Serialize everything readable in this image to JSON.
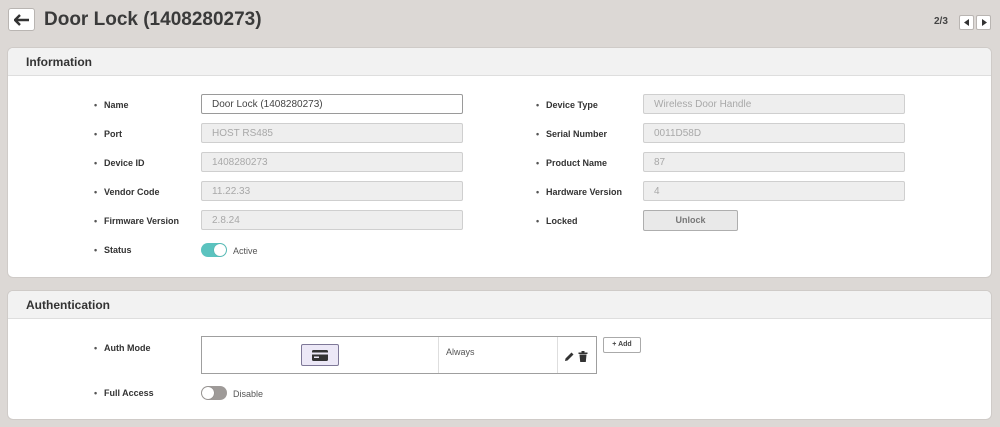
{
  "header": {
    "title": "Door Lock (1408280273)",
    "pager": "2/3"
  },
  "information": {
    "section_title": "Information",
    "left_fields": [
      {
        "label": "Name",
        "value": "Door Lock (1408280273)"
      },
      {
        "label": "Port",
        "value": "HOST RS485"
      },
      {
        "label": "Device ID",
        "value": "1408280273"
      },
      {
        "label": "Vendor Code",
        "value": "11.22.33"
      },
      {
        "label": "Firmware Version",
        "value": "2.8.24"
      }
    ],
    "status": {
      "label": "Status",
      "value": "Active"
    },
    "right_fields": [
      {
        "label": "Device Type",
        "value": "Wireless Door Handle"
      },
      {
        "label": "Serial Number",
        "value": "0011D58D"
      },
      {
        "label": "Product Name",
        "value": "87"
      },
      {
        "label": "Hardware Version",
        "value": "4"
      }
    ],
    "locked": {
      "label": "Locked",
      "button": "Unlock"
    }
  },
  "authentication": {
    "section_title": "Authentication",
    "auth_mode": {
      "label": "Auth Mode",
      "rows": [
        {
          "mode_icon": "card-icon",
          "schedule": "Always"
        }
      ],
      "add_label": "+ Add"
    },
    "full_access": {
      "label": "Full Access",
      "value": "Disable"
    }
  },
  "colors": {
    "toggle_on": "#5bc3bf",
    "toggle_off": "#9e9a98",
    "card_button_bg": "#ece8f7"
  }
}
